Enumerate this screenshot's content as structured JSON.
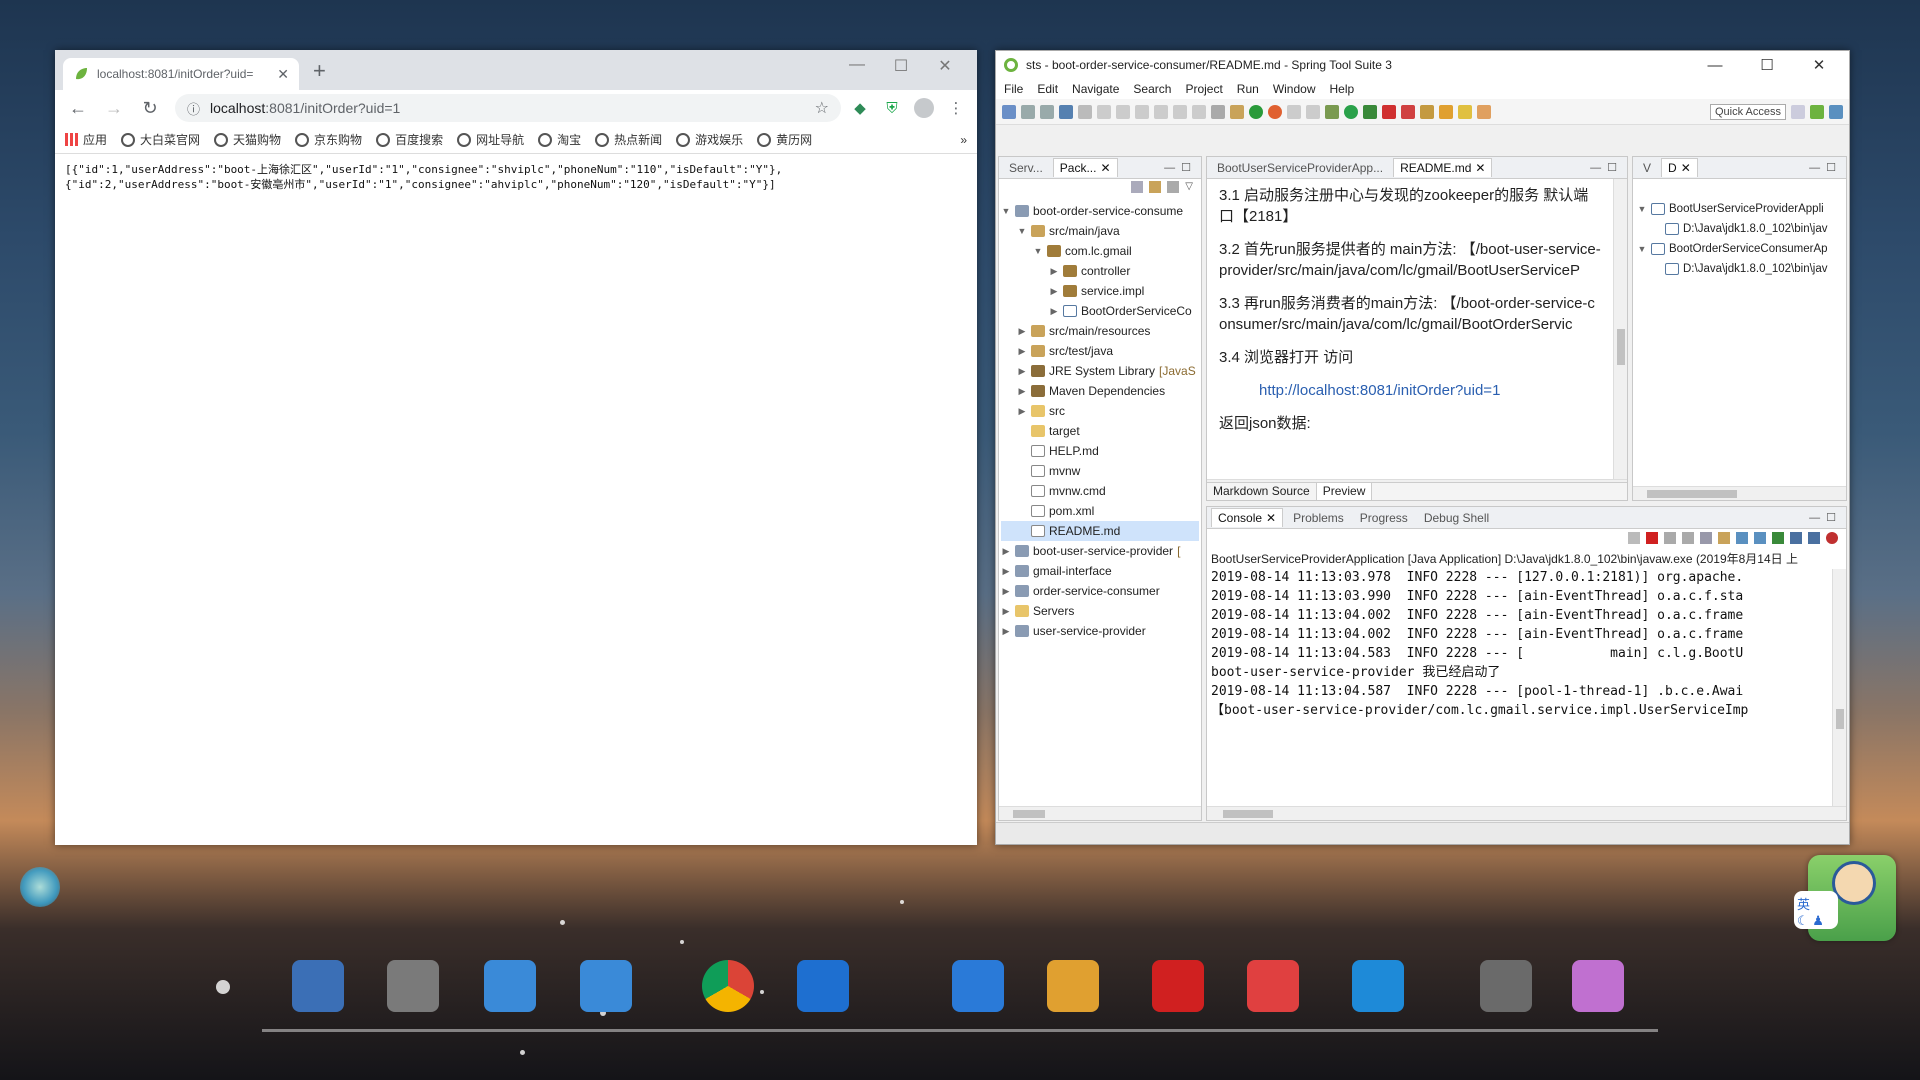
{
  "chrome": {
    "tab_title": "localhost:8081/initOrder?uid=",
    "address_host": "localhost",
    "address_rest": ":8081/initOrder?uid=1",
    "bookmarks": [
      "应用",
      "大白菜官网",
      "天猫购物",
      "京东购物",
      "百度搜索",
      "网址导航",
      "淘宝",
      "热点新闻",
      "游戏娱乐",
      "黄历网"
    ],
    "content_lines": [
      "[{\"id\":1,\"userAddress\":\"boot-上海徐汇区\",\"userId\":\"1\",\"consignee\":\"shviplc\",\"phoneNum\":\"110\",\"isDefault\":\"Y\"},",
      "{\"id\":2,\"userAddress\":\"boot-安徽亳州市\",\"userId\":\"1\",\"consignee\":\"ahviplc\",\"phoneNum\":\"120\",\"isDefault\":\"Y\"}]"
    ]
  },
  "sts": {
    "title": "sts - boot-order-service-consumer/README.md - Spring Tool Suite 3",
    "menu": [
      "File",
      "Edit",
      "Navigate",
      "Search",
      "Project",
      "Run",
      "Window",
      "Help"
    ],
    "quick_access": "Quick Access",
    "explorer_tabs": [
      "Serv...",
      "Pack..."
    ],
    "tree": [
      {
        "label": "boot-order-service-consume",
        "indent": 0,
        "ex": "v",
        "icon": "proj"
      },
      {
        "label": "src/main/java",
        "indent": 1,
        "ex": "v",
        "icon": "pkg"
      },
      {
        "label": "com.lc.gmail",
        "indent": 2,
        "ex": "v",
        "icon": "pk2"
      },
      {
        "label": "controller",
        "indent": 3,
        "ex": ">",
        "icon": "pk2"
      },
      {
        "label": "service.impl",
        "indent": 3,
        "ex": ">",
        "icon": "pk2"
      },
      {
        "label": "BootOrderServiceCo",
        "indent": 3,
        "ex": ">",
        "icon": "java"
      },
      {
        "label": "src/main/resources",
        "indent": 1,
        "ex": ">",
        "icon": "pkg"
      },
      {
        "label": "src/test/java",
        "indent": 1,
        "ex": ">",
        "icon": "pkg"
      },
      {
        "label": "JRE System Library",
        "suffix": "[JavaS",
        "indent": 1,
        "ex": ">",
        "icon": "jre"
      },
      {
        "label": "Maven Dependencies",
        "indent": 1,
        "ex": ">",
        "icon": "jre"
      },
      {
        "label": "src",
        "indent": 1,
        "ex": ">",
        "icon": "fold"
      },
      {
        "label": "target",
        "indent": 1,
        "ex": "",
        "icon": "fold"
      },
      {
        "label": "HELP.md",
        "indent": 1,
        "ex": "",
        "icon": "file"
      },
      {
        "label": "mvnw",
        "indent": 1,
        "ex": "",
        "icon": "file"
      },
      {
        "label": "mvnw.cmd",
        "indent": 1,
        "ex": "",
        "icon": "file"
      },
      {
        "label": "pom.xml",
        "indent": 1,
        "ex": "",
        "icon": "file"
      },
      {
        "label": "README.md",
        "indent": 1,
        "ex": "",
        "icon": "file",
        "selected": true
      },
      {
        "label": "boot-user-service-provider",
        "suffix": "[",
        "indent": 0,
        "ex": ">",
        "icon": "proj"
      },
      {
        "label": "gmail-interface",
        "indent": 0,
        "ex": ">",
        "icon": "proj"
      },
      {
        "label": "order-service-consumer",
        "indent": 0,
        "ex": ">",
        "icon": "proj"
      },
      {
        "label": "Servers",
        "indent": 0,
        "ex": ">",
        "icon": "fold"
      },
      {
        "label": "user-service-provider",
        "indent": 0,
        "ex": ">",
        "icon": "proj"
      }
    ],
    "editor_tabs": [
      "BootUserServiceProviderApp...",
      "README.md"
    ],
    "md": {
      "p1": "3.1 启动服务注册中心与发现的zookeeper的服务 默认端口【2181】",
      "p2": "3.2 首先run服务提供者的 main方法: 【/boot-user-service-provider/src/main/java/com/lc/gmail/BootUserServiceP",
      "p3": "3.3 再run服务消费者的main方法: 【/boot-order-service-consumer/src/main/java/com/lc/gmail/BootOrderServic",
      "p4": "3.4 浏览器打开 访问",
      "link": "http://localhost:8081/initOrder?uid=1",
      "p5": "返回json数据:"
    },
    "md_tabs": [
      "Markdown Source",
      "Preview"
    ],
    "debug_tabs": [
      "V",
      "D"
    ],
    "debug_items": [
      {
        "label": "BootUserServiceProviderAppli",
        "indent": 0
      },
      {
        "label": "D:\\Java\\jdk1.8.0_102\\bin\\jav",
        "indent": 1
      },
      {
        "label": "BootOrderServiceConsumerAp",
        "indent": 0
      },
      {
        "label": "D:\\Java\\jdk1.8.0_102\\bin\\jav",
        "indent": 1
      }
    ],
    "console_tabs": [
      "Console",
      "Problems",
      "Progress",
      "Debug Shell"
    ],
    "console_header": "BootUserServiceProviderApplication [Java Application] D:\\Java\\jdk1.8.0_102\\bin\\javaw.exe (2019年8月14日 上",
    "console_lines": [
      "2019-08-14 11:13:03.978  INFO 2228 --- [127.0.0.1:2181)] org.apache.",
      "2019-08-14 11:13:03.990  INFO 2228 --- [ain-EventThread] o.a.c.f.sta",
      "2019-08-14 11:13:04.002  INFO 2228 --- [ain-EventThread] o.a.c.frame",
      "2019-08-14 11:13:04.002  INFO 2228 --- [ain-EventThread] o.a.c.frame",
      "2019-08-14 11:13:04.583  INFO 2228 --- [           main] c.l.g.BootU",
      "boot-user-service-provider 我已经启动了",
      "2019-08-14 11:13:04.587  INFO 2228 --- [pool-1-thread-1] .b.c.e.Awai",
      "【boot-user-service-provider/com.lc.gmail.service.impl.UserServiceImp"
    ]
  },
  "dock": [
    "computer",
    "files",
    "ie-folder",
    "store",
    "chrome",
    "edge-ie",
    "windows-store",
    "pinwheel",
    "it-app",
    "la-pin",
    "search",
    "windows",
    "tools"
  ]
}
